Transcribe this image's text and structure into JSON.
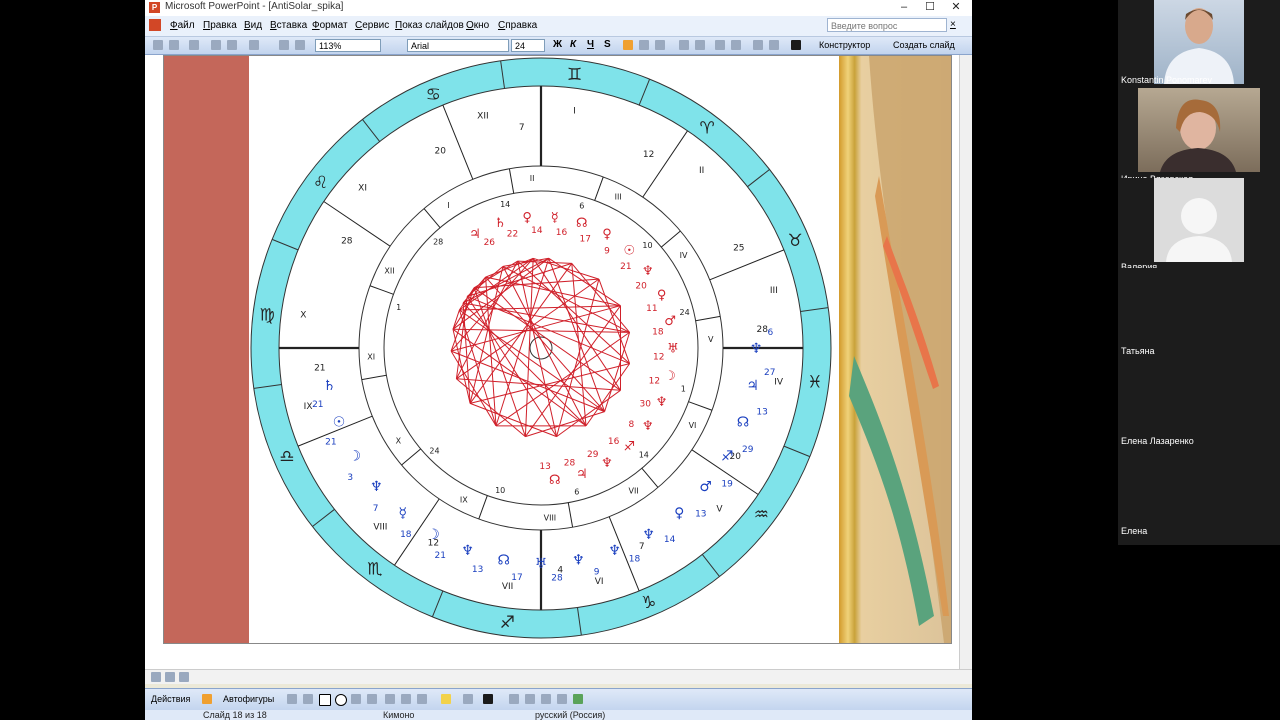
{
  "window": {
    "title": "Microsoft PowerPoint - [AntiSolar_spika]",
    "app_icon": "powerpoint-icon",
    "controls": [
      "minimize-icon",
      "maximize-icon",
      "close-icon"
    ]
  },
  "menu": {
    "items": [
      "Файл",
      "Правка",
      "Вид",
      "Вставка",
      "Формат",
      "Сервис",
      "Показ слайдов",
      "Окно",
      "Справка"
    ],
    "help_placeholder": "Введите вопрос"
  },
  "toolbar": {
    "zoom": "113%",
    "font_name": "Arial",
    "font_size": "24",
    "bold": "Ж",
    "italic": "К",
    "underline": "Ч",
    "shadow": "S",
    "designer": "Конструктор",
    "new_slide": "Создать слайд"
  },
  "drawing": {
    "actions": "Действия",
    "autoshapes": "Автофигуры"
  },
  "status": {
    "slide": "Слайд 18 из 18",
    "design": "Кимоно",
    "language": "русский (Россия)"
  },
  "chart": {
    "houses_outer": [
      "X",
      "XI",
      "XII",
      "I",
      "II",
      "III",
      "IV",
      "V",
      "VI",
      "VII",
      "VIII",
      "IX"
    ],
    "house_degrees_outer": [
      "21",
      "28",
      "20",
      "7",
      "12",
      "25",
      "28",
      "20",
      "7",
      "4",
      "12"
    ],
    "houses_inner": [
      "XII",
      "I",
      "II",
      "III",
      "IV",
      "V",
      "VI",
      "VII",
      "VIII",
      "IX",
      "X",
      "XI"
    ],
    "house_degrees_inner": [
      "1",
      "28",
      "14",
      "6",
      "10",
      "24",
      "1",
      "14",
      "6",
      "10",
      "24"
    ],
    "planets_outer": [
      {
        "glyph": "♄",
        "deg": "21",
        "color": "#1a3fbf"
      },
      {
        "glyph": "☉",
        "deg": "21",
        "color": "#1a3fbf"
      },
      {
        "glyph": "☽",
        "deg": "3",
        "color": "#1a3fbf"
      },
      {
        "glyph": "♆",
        "deg": "7",
        "color": "#1a3fbf"
      },
      {
        "glyph": "☿",
        "deg": "18",
        "color": "#1a3fbf"
      },
      {
        "glyph": "☽",
        "deg": "21",
        "color": "#1a3fbf"
      },
      {
        "glyph": "♆",
        "deg": "13",
        "color": "#1a3fbf"
      },
      {
        "glyph": "☊",
        "deg": "17",
        "color": "#1a3fbf"
      },
      {
        "glyph": "♅",
        "deg": "28",
        "color": "#1a3fbf"
      },
      {
        "glyph": "♆",
        "deg": "9",
        "color": "#1a3fbf"
      },
      {
        "glyph": "♆",
        "deg": "18",
        "color": "#1a3fbf"
      },
      {
        "glyph": "♆",
        "deg": "14",
        "color": "#1a3fbf"
      },
      {
        "glyph": "♀",
        "deg": "13",
        "color": "#1a3fbf"
      },
      {
        "glyph": "♂",
        "deg": "19",
        "color": "#1a3fbf"
      },
      {
        "glyph": "♐",
        "deg": "29",
        "color": "#1a3fbf"
      },
      {
        "glyph": "☊",
        "deg": "13",
        "color": "#1a3fbf"
      },
      {
        "glyph": "♃",
        "deg": "27",
        "color": "#1a3fbf"
      },
      {
        "glyph": "♆",
        "deg": "6",
        "color": "#1a3fbf"
      }
    ],
    "planets_inner": [
      {
        "glyph": "♃",
        "deg": "26",
        "color": "#d0202a"
      },
      {
        "glyph": "♄",
        "deg": "22",
        "color": "#d0202a"
      },
      {
        "glyph": "♀",
        "deg": "14",
        "color": "#d0202a"
      },
      {
        "glyph": "☿",
        "deg": "16",
        "color": "#d0202a"
      },
      {
        "glyph": "☊",
        "deg": "17",
        "color": "#d0202a"
      },
      {
        "glyph": "♀",
        "deg": "9",
        "color": "#d0202a"
      },
      {
        "glyph": "☉",
        "deg": "21",
        "color": "#d0202a"
      },
      {
        "glyph": "♆",
        "deg": "20",
        "color": "#d0202a"
      },
      {
        "glyph": "♀",
        "deg": "11",
        "color": "#d0202a"
      },
      {
        "glyph": "♂",
        "deg": "18",
        "color": "#d0202a"
      },
      {
        "glyph": "♅",
        "deg": "12",
        "color": "#d0202a"
      },
      {
        "glyph": "☽",
        "deg": "12",
        "color": "#d0202a"
      },
      {
        "glyph": "♆",
        "deg": "30",
        "color": "#d0202a"
      },
      {
        "glyph": "♆",
        "deg": "8",
        "color": "#d0202a"
      },
      {
        "glyph": "♐",
        "deg": "16",
        "color": "#d0202a"
      },
      {
        "glyph": "♆",
        "deg": "29",
        "color": "#d0202a"
      },
      {
        "glyph": "♃",
        "deg": "28",
        "color": "#d0202a"
      },
      {
        "glyph": "☊",
        "deg": "13",
        "color": "#d0202a"
      }
    ],
    "zodiac": [
      "♊",
      "♈",
      "♉",
      "♓",
      "♒",
      "♑",
      "♐",
      "♏",
      "♎",
      "♍",
      "♌",
      "♋"
    ],
    "colors": {
      "ring": "#7fe3ea",
      "blue": "#1a3fbf",
      "red": "#d0202a"
    }
  },
  "participants": [
    {
      "name": "Konstantin Ponomarev",
      "video": true
    },
    {
      "name": "Ирина Вязовская",
      "video": true
    },
    {
      "name": "Валерия",
      "video": false
    },
    {
      "name": "Татьяна",
      "video": false
    },
    {
      "name": "Елена Лазаренко",
      "video": false
    },
    {
      "name": "Елена",
      "video": false
    }
  ]
}
